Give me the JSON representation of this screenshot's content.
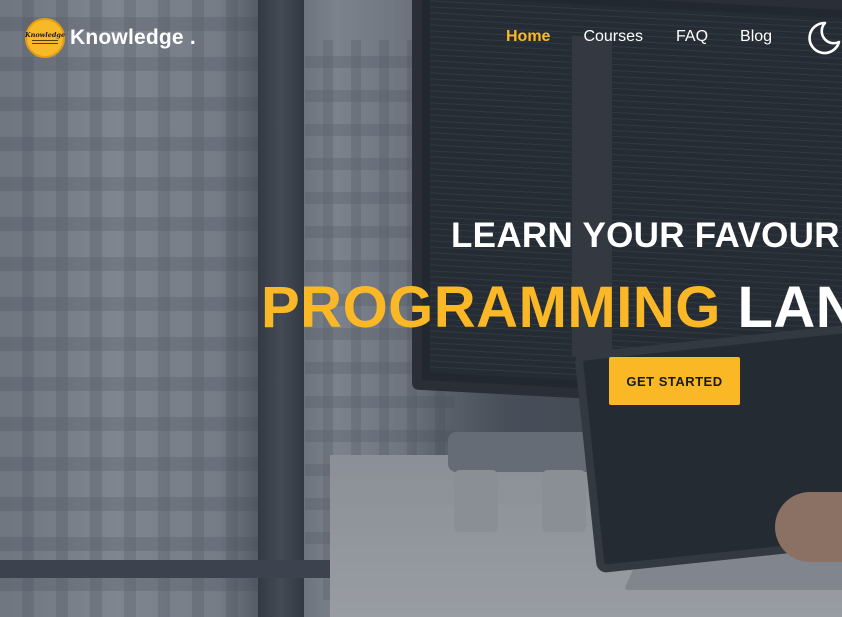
{
  "brand": {
    "badge_text": "Knowledge",
    "name": "Knowledge ."
  },
  "nav": {
    "items": [
      {
        "label": "Home",
        "active": true
      },
      {
        "label": "Courses",
        "active": false
      },
      {
        "label": "FAQ",
        "active": false
      },
      {
        "label": "Blog",
        "active": false
      }
    ],
    "theme_toggle_icon": "moon-icon"
  },
  "hero": {
    "line1": "LEARN YOUR FAVOUR",
    "line2_accent": "PROGRAMMING",
    "line2_rest": " LAN",
    "cta_label": "GET STARTED"
  },
  "colors": {
    "accent": "#fbb826",
    "text": "#ffffff",
    "cta_text": "#1a1a1a"
  }
}
